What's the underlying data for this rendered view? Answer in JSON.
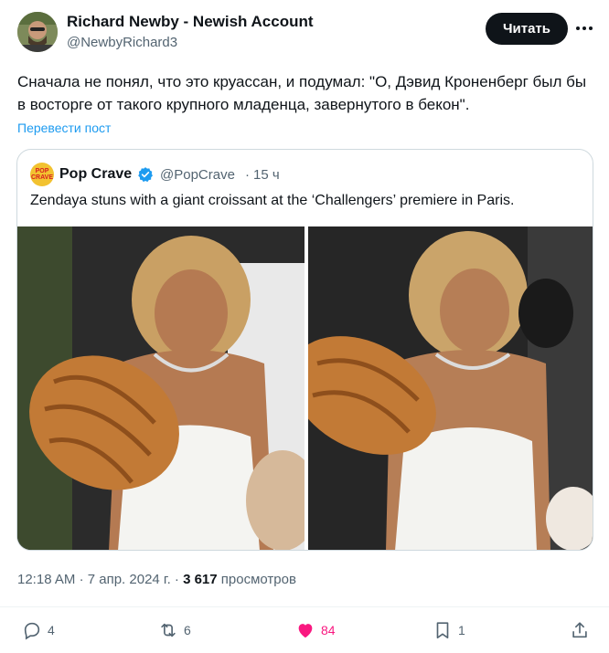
{
  "author": {
    "name": "Richard Newby - Newish Account",
    "handle": "@NewbyRichard3",
    "follow_label": "Читать"
  },
  "tweet": {
    "text": "Сначала не понял, что это круассан, и подумал: \"О, Дэвид Кроненберг был бы в восторге от такого крупного младенца, завернутого в бекон\".",
    "translate_label": "Перевести пост"
  },
  "quoted": {
    "avatar_text": "POP CRAVE",
    "name": "Pop Crave",
    "handle": "@PopCrave",
    "separator": "·",
    "time": "15 ч",
    "text": "Zendaya stuns with a giant croissant at the ‘Challengers’ premiere in Paris."
  },
  "meta": {
    "time": "12:18 AM",
    "dot": "·",
    "date": "7 апр. 2024 г.",
    "views_count": "3 617",
    "views_label": "просмотров"
  },
  "actions": {
    "replies": "4",
    "reposts": "6",
    "likes": "84",
    "bookmarks": "1"
  },
  "colors": {
    "accent": "#1d9bf0",
    "like": "#f91880",
    "text": "#0f1419",
    "secondary": "#536471"
  }
}
